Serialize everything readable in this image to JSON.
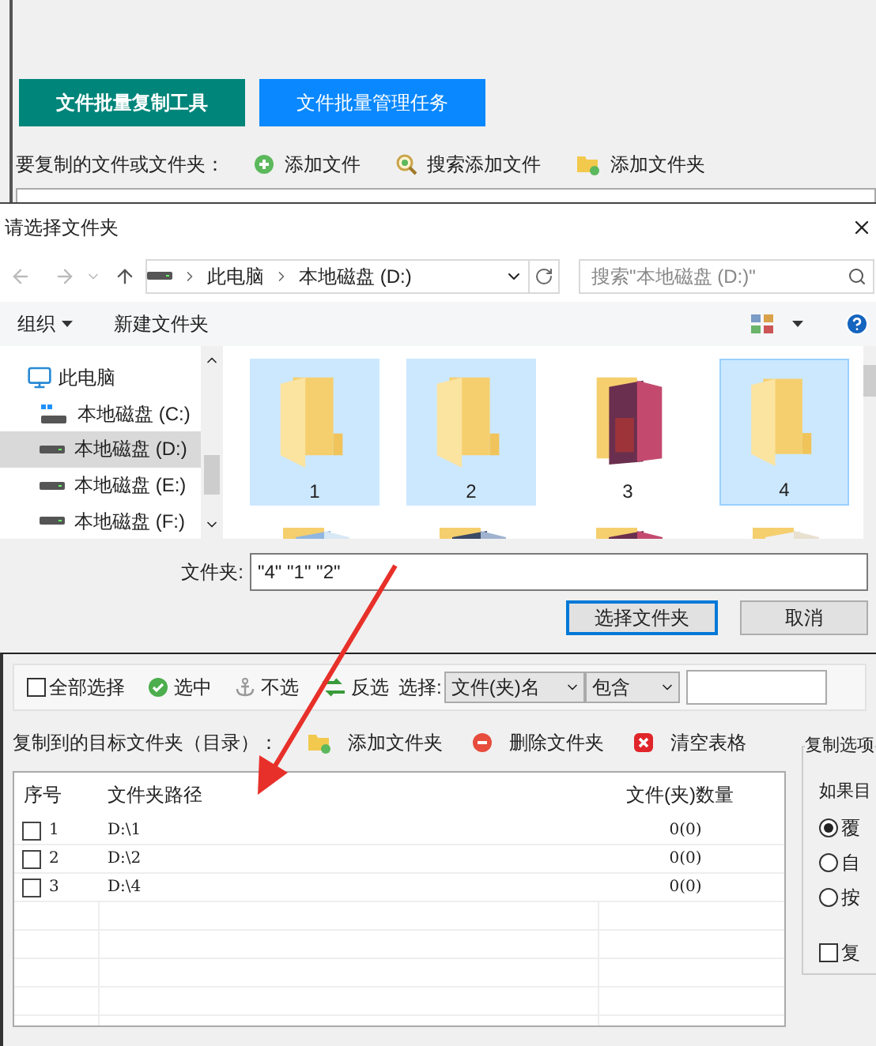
{
  "app_tabs": [
    {
      "label": "文件批量复制工具",
      "selected": true
    },
    {
      "label": "文件批量管理任务",
      "selected": false
    }
  ],
  "source_toolbar": {
    "label": "要复制的文件或文件夹：",
    "buttons": [
      {
        "label": "添加文件",
        "kind": "add"
      },
      {
        "label": "搜索添加文件",
        "kind": "search"
      },
      {
        "label": "添加文件夹",
        "kind": "folder"
      }
    ]
  },
  "dialog": {
    "title": "请选择文件夹",
    "breadcrumb": [
      "此电脑",
      "本地磁盘 (D:)"
    ],
    "search": {
      "placeholder": "搜索\"本地磁盘 (D:)\""
    },
    "toolbar": [
      {
        "label": "组织",
        "kind": "menu"
      },
      {
        "label": "新建文件夹",
        "kind": "plain"
      }
    ],
    "nav": [
      {
        "label": "此电脑",
        "kind": "pc",
        "selected": false,
        "children": [
          {
            "label": "本地磁盘 (C:)",
            "kind": "system",
            "selected": false
          },
          {
            "label": "本地磁盘 (D:)",
            "kind": "drive",
            "selected": true
          },
          {
            "label": "本地磁盘 (E:)",
            "kind": "drive",
            "selected": false
          },
          {
            "label": "本地磁盘 (F:)",
            "kind": "drive",
            "selected": false
          }
        ]
      }
    ],
    "folders": [
      {
        "label": "1",
        "kind": "empty",
        "selected": true
      },
      {
        "label": "2",
        "kind": "empty",
        "selected": true
      },
      {
        "label": "3",
        "kind": "picture",
        "selected": false
      },
      {
        "label": "4",
        "kind": "empty",
        "selected": true
      }
    ],
    "more_folders": [
      {
        "kind": "picture"
      },
      {
        "kind": "picture"
      },
      {
        "kind": "picture"
      },
      {
        "kind": "picture"
      }
    ],
    "folder_field": {
      "label": "文件夹:",
      "value": "\"4\" \"1\" \"2\""
    },
    "buttons": [
      {
        "label": "选择文件夹",
        "kind": "primary"
      },
      {
        "label": "取消",
        "kind": "normal"
      }
    ]
  },
  "filter_bar": {
    "select_all": {
      "label": "全部选择",
      "checked": false
    },
    "buttons": [
      {
        "label": "选中",
        "kind": "check"
      },
      {
        "label": "不选",
        "kind": "anchor"
      },
      {
        "label": "反选",
        "kind": "swap"
      }
    ],
    "select_label": "选择:",
    "field_select": "文件(夹)名",
    "match_select": "包含"
  },
  "target": {
    "label": "复制到的目标文件夹（目录）：",
    "buttons": [
      {
        "label": "添加文件夹",
        "kind": "folder"
      },
      {
        "label": "删除文件夹",
        "kind": "remove"
      },
      {
        "label": "清空表格",
        "kind": "clear"
      }
    ],
    "columns": [
      "序号",
      "文件夹路径",
      "文件(夹)数量"
    ],
    "rows": [
      {
        "index": "1",
        "path": "D:\\1",
        "count": "0(0)",
        "checked": false
      },
      {
        "index": "2",
        "path": "D:\\2",
        "count": "0(0)",
        "checked": false
      },
      {
        "index": "3",
        "path": "D:\\4",
        "count": "0(0)",
        "checked": false
      }
    ]
  },
  "options": {
    "title": "复制选项",
    "prompt": "如果目",
    "radios": [
      {
        "label": "覆",
        "selected": true
      },
      {
        "label": "自",
        "selected": false
      },
      {
        "label": "按",
        "selected": false
      }
    ],
    "checkbox": {
      "label": "复",
      "checked": false
    }
  }
}
